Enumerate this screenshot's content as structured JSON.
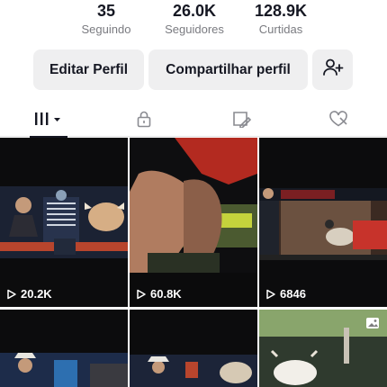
{
  "stats": [
    {
      "value": "35",
      "label": "Seguindo"
    },
    {
      "value": "26.0K",
      "label": "Seguidores"
    },
    {
      "value": "128.9K",
      "label": "Curtidas"
    }
  ],
  "actions": {
    "edit_label": "Editar Perfil",
    "share_label": "Compartilhar perfil",
    "add_friend_icon": "person-add-icon"
  },
  "tabs": [
    {
      "icon": "grid-icon",
      "active": true
    },
    {
      "icon": "lock-icon",
      "active": false
    },
    {
      "icon": "saved-icon",
      "active": false
    },
    {
      "icon": "liked-icon",
      "active": false
    }
  ],
  "videos": [
    {
      "views": "20.2K"
    },
    {
      "views": "60.8K"
    },
    {
      "views": "6846"
    },
    {
      "views": ""
    },
    {
      "views": ""
    },
    {
      "views": ""
    }
  ],
  "colors": {
    "text": "#161823",
    "muted": "#7a7b80",
    "button_bg": "#efeff0",
    "accent_red": "#c0392b"
  }
}
